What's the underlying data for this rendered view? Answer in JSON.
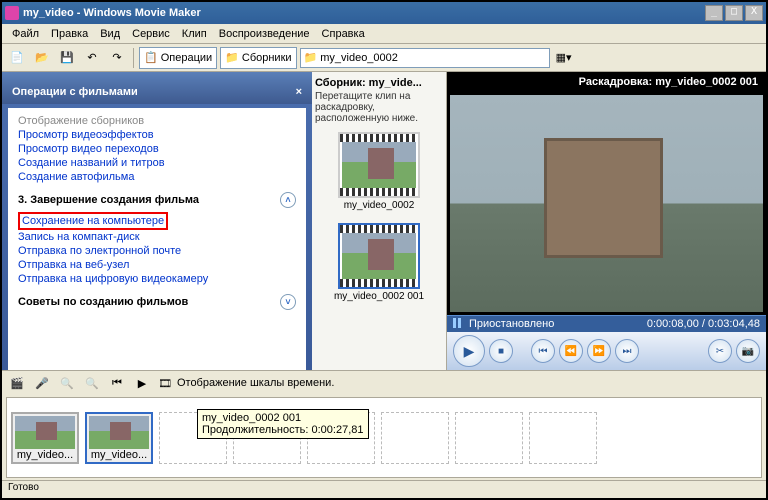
{
  "title": "my_video - Windows Movie Maker",
  "winbtns": {
    "min": "_",
    "max": "□",
    "close": "X"
  },
  "menu": [
    "Файл",
    "Правка",
    "Вид",
    "Сервис",
    "Клип",
    "Воспроизведение",
    "Справка"
  ],
  "toolbar": {
    "operations": "Операции",
    "collections": "Сборники",
    "combo": "my_video_0002"
  },
  "tasks": {
    "header": "Операции с фильмами",
    "gray": "Отображение сборников",
    "links1": [
      "Просмотр видеоэффектов",
      "Просмотр видео переходов",
      "Создание названий и титров",
      "Создание автофильма"
    ],
    "sec3": "3. Завершение создания фильма",
    "links3": [
      "Сохранение на компьютере",
      "Запись на компакт-диск",
      "Отправка по электронной почте",
      "Отправка на веб-узел",
      "Отправка на цифровую видеокамеру"
    ],
    "tips": "Советы по созданию фильмов"
  },
  "coll": {
    "header": "Сборник: my_vide...",
    "sub": "Перетащите клип на раскадровку, расположенную ниже.",
    "item1": "my_video_0002",
    "item2": "my_video_0002 001"
  },
  "player": {
    "title": "Раскадровка: my_video_0002 001",
    "status": "Приостановлено",
    "time": "0:00:08,00 / 0:03:04,48"
  },
  "bottom": {
    "label": "Отображение шкалы времени.",
    "clip1": "my_video...",
    "clip2": "my_video...",
    "tooltip_l1": "my_video_0002 001",
    "tooltip_l2": "Продолжительность:  0:00:27,81"
  },
  "status": "Готово"
}
